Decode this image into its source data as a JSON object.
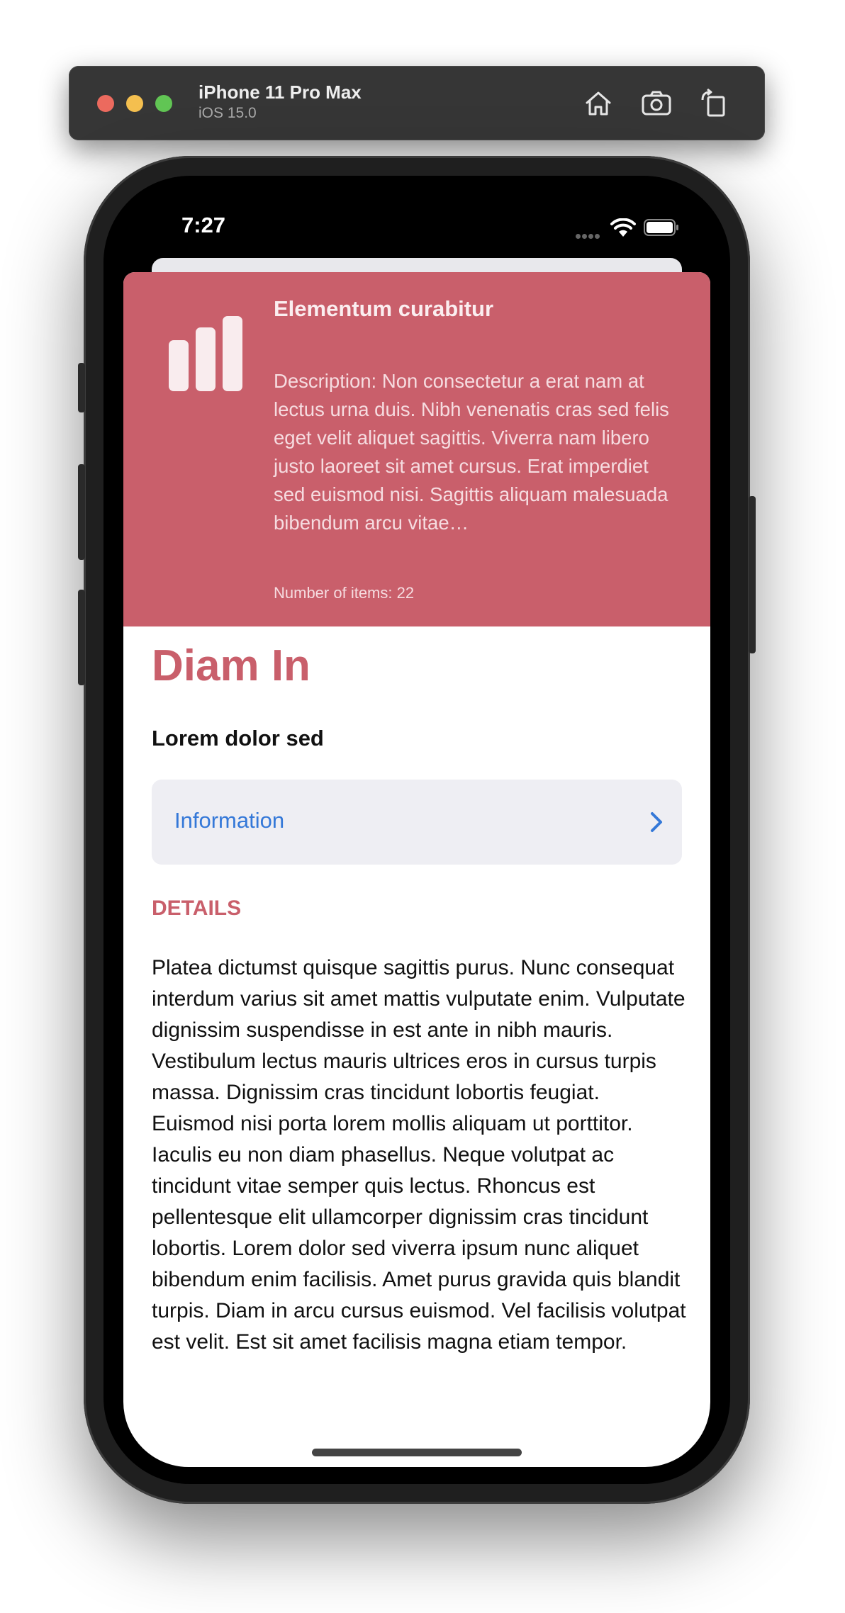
{
  "simulator": {
    "device_name": "iPhone 11 Pro Max",
    "os_version": "iOS 15.0",
    "buttons": [
      "home-icon",
      "screenshot-icon",
      "rotate-icon"
    ]
  },
  "status_bar": {
    "time": "7:27"
  },
  "hero": {
    "icon": "bar-chart-icon",
    "title": "Elementum curabitur",
    "description": "Description: Non consectetur a erat nam at lectus urna duis. Nibh venenatis cras sed felis eget velit aliquet sagittis. Viverra nam libero justo laoreet sit amet cursus. Erat imperdiet sed euismod nisi. Sagittis aliquam malesuada bibendum arcu vitae…",
    "item_count": "Number of items: 22",
    "background_color": "#c95f6b"
  },
  "content": {
    "title": "Diam In",
    "subtitle": "Lorem dolor sed",
    "info_row_label": "Information",
    "section_header": "DETAILS",
    "body": "Platea dictumst quisque sagittis purus. Nunc consequat interdum varius sit amet mattis vulputate enim. Vulputate dignissim suspendisse in est ante in nibh mauris. Vestibulum lectus mauris ultrices eros in cursus turpis massa. Dignissim cras tincidunt lobortis feugiat. Euismod nisi porta lorem mollis aliquam ut porttitor. Iaculis eu non diam phasellus. Neque volutpat ac tincidunt vitae semper quis lectus. Rhoncus est pellentesque elit ullamcorper dignissim cras tincidunt lobortis. Lorem dolor sed viverra ipsum nunc aliquet bibendum enim facilisis. Amet purus gravida quis blandit turpis. Diam in arcu cursus euismod. Vel facilisis volutpat est velit. Est sit amet facilisis magna etiam tempor."
  },
  "colors": {
    "accent": "#c95f6b",
    "link": "#3478d8",
    "row_background": "#eeeef3"
  }
}
